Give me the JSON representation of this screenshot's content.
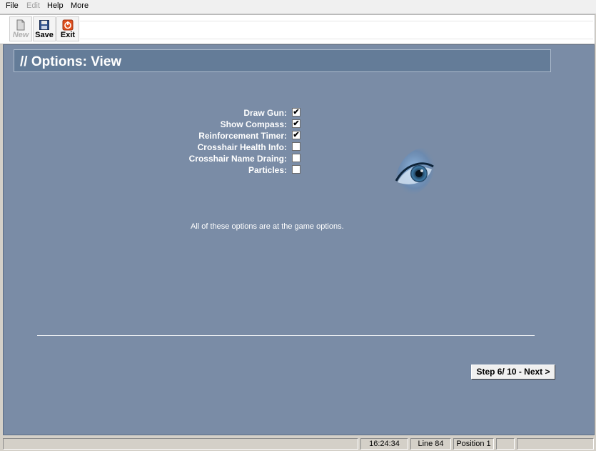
{
  "menu": {
    "items": [
      {
        "label": "File",
        "enabled": true
      },
      {
        "label": "Edit",
        "enabled": false
      },
      {
        "label": "Help",
        "enabled": true
      },
      {
        "label": "More",
        "enabled": true
      }
    ]
  },
  "toolbar": {
    "new_label": "New",
    "save_label": "Save",
    "exit_label": "Exit",
    "icons": [
      "document-icon",
      "floppy-disk-icon",
      "power-icon"
    ]
  },
  "page": {
    "title": "// Options: View",
    "options": [
      {
        "label": "Draw Gun:",
        "checked": true
      },
      {
        "label": "Show Compass:",
        "checked": true
      },
      {
        "label": "Reinforcement Timer:",
        "checked": true
      },
      {
        "label": "Crosshair Health Info:",
        "checked": false
      },
      {
        "label": "Crosshair Name Draing:",
        "checked": false
      },
      {
        "label": "Particles:",
        "checked": false
      }
    ],
    "note": "All of these options are at the game options.",
    "eye_icon": "eye-icon",
    "next_button": "Step 6/ 10 - Next >"
  },
  "status": {
    "time": "16:24:34",
    "line": "Line 84",
    "position": "Position 1"
  },
  "colors": {
    "content_bg": "#7a8ca6",
    "title_bg": "#647c98",
    "eye_iris": "#2f5f86"
  }
}
